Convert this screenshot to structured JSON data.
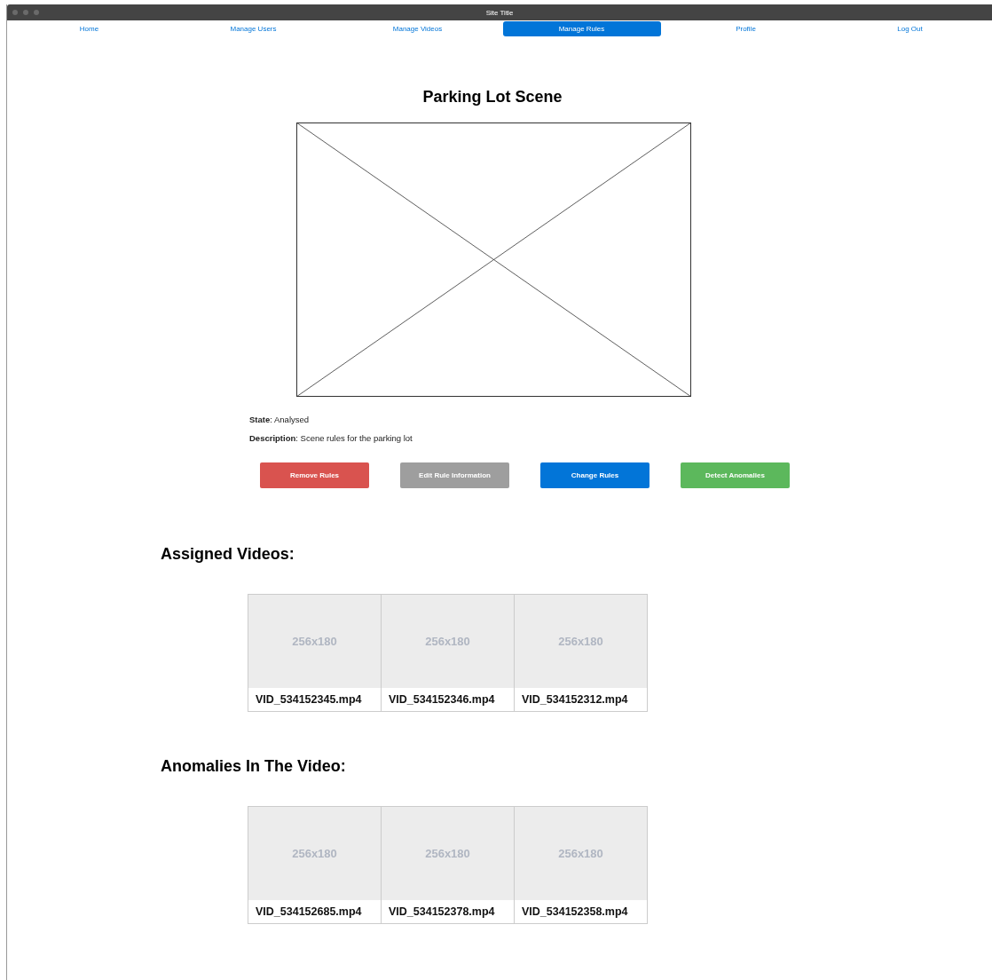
{
  "window": {
    "title": "Site Title"
  },
  "nav": [
    {
      "label": "Home",
      "selected": false
    },
    {
      "label": "Manage Users",
      "selected": false
    },
    {
      "label": "Manage Videos",
      "selected": false
    },
    {
      "label": "Manage Rules",
      "selected": true
    },
    {
      "label": "Profile",
      "selected": false
    },
    {
      "label": "Log Out",
      "selected": false
    }
  ],
  "scene": {
    "title": "Parking Lot Scene",
    "state": "**State**: Analysed",
    "description": "**Description**: Scene rules for the parking lot"
  },
  "buttons": [
    {
      "label": "Remove Rules",
      "color": "#d9534f"
    },
    {
      "label": "Edit Rule Information",
      "color": "#9e9e9e"
    },
    {
      "label": "Change Rules",
      "color": "#0275d8"
    },
    {
      "label": "Detect Anomalies",
      "color": "#5cb85c"
    }
  ],
  "sections": [
    {
      "title": "Assigned Videos:",
      "videos": [
        {
          "thumb": "256x180",
          "name": "VID_534152345.mp4"
        },
        {
          "thumb": "256x180",
          "name": "VID_534152346.mp4"
        },
        {
          "thumb": "256x180",
          "name": "VID_534152312.mp4"
        }
      ]
    },
    {
      "title": "Anomalies In The Video:",
      "videos": [
        {
          "thumb": "256x180",
          "name": "VID_534152685.mp4"
        },
        {
          "thumb": "256x180",
          "name": "VID_534152378.mp4"
        },
        {
          "thumb": "256x180",
          "name": "VID_534152358.mp4"
        }
      ]
    }
  ]
}
